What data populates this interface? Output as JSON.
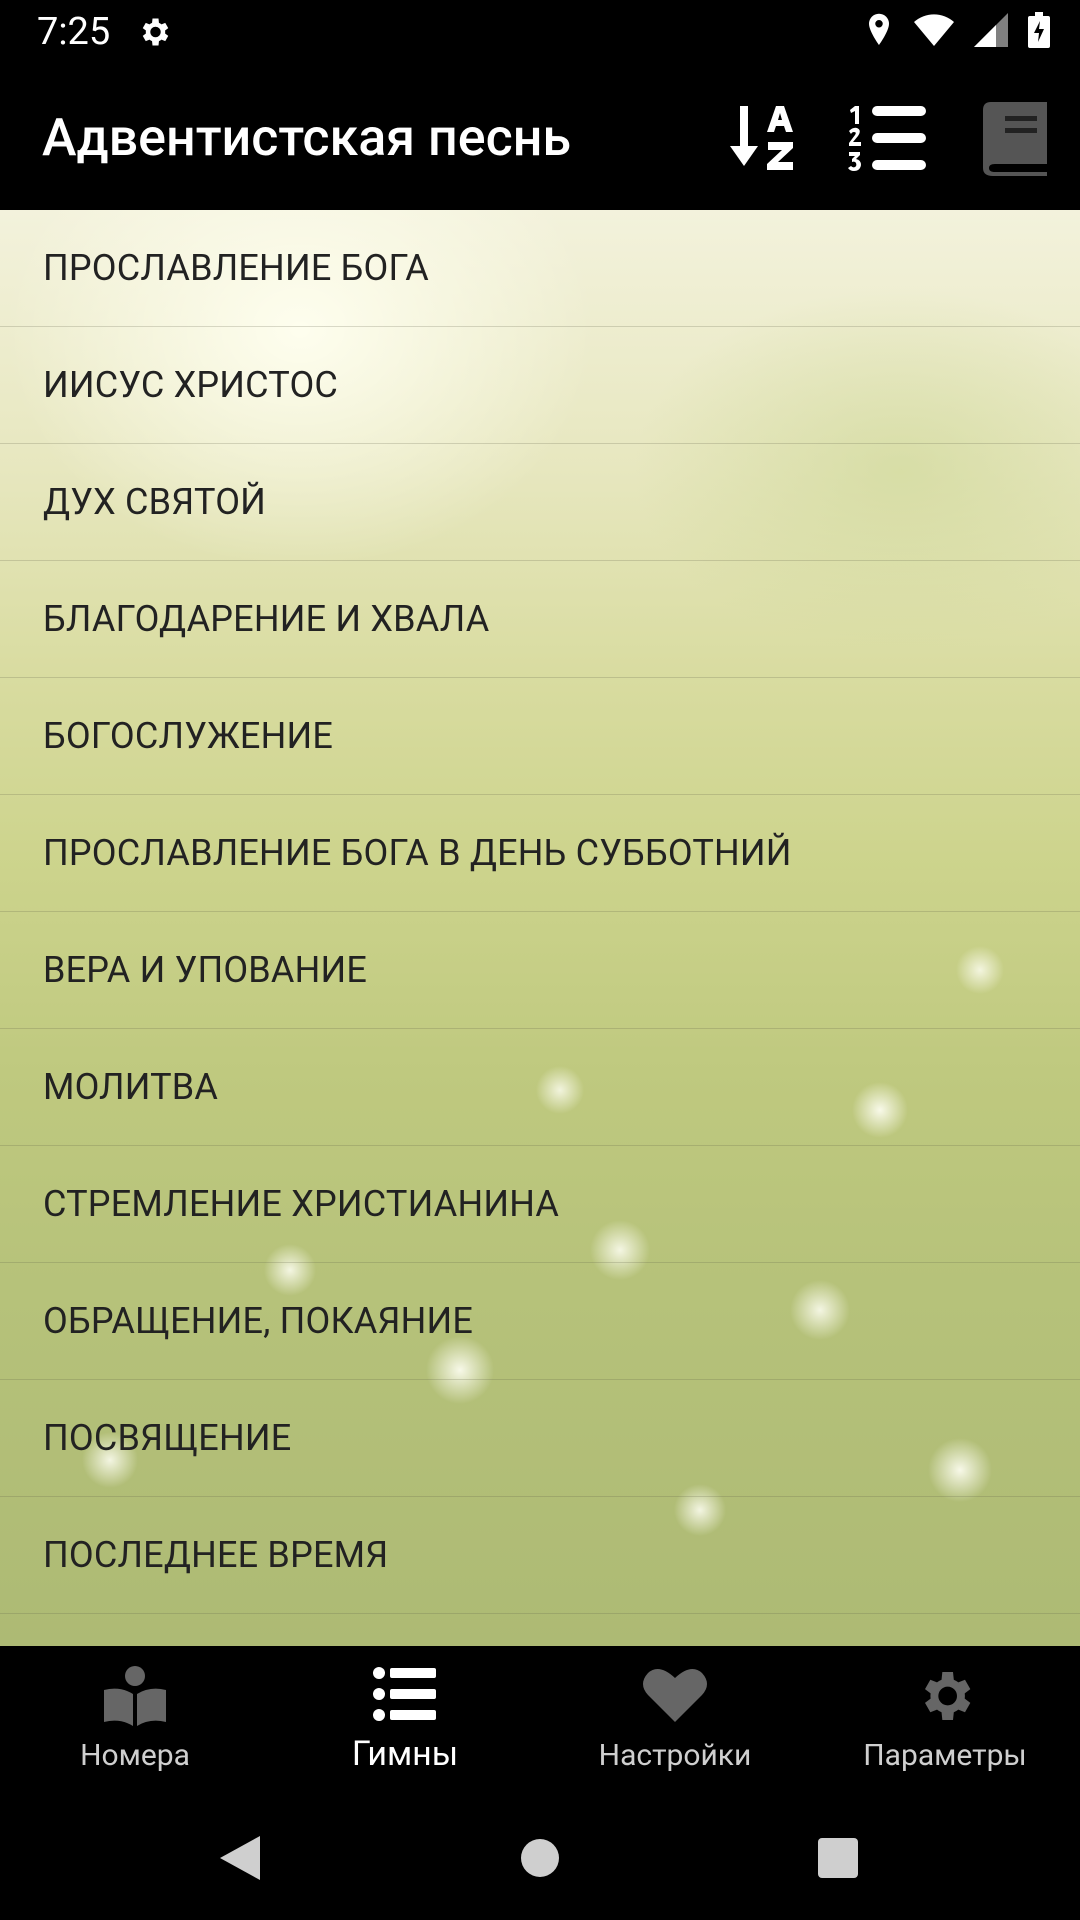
{
  "status_bar": {
    "time": "7:25",
    "icons": [
      "gear-icon",
      "location-icon",
      "wifi-icon",
      "signal-icon",
      "battery-icon"
    ]
  },
  "app_bar": {
    "title": "Адвентистская песнь",
    "actions": [
      "sort-alpha-icon",
      "sort-numeric-icon",
      "book-icon"
    ]
  },
  "categories": [
    "ПРОСЛАВЛЕНИЕ БОГА",
    "ИИСУС ХРИСТОС",
    "ДУХ СВЯТОЙ",
    "БЛАГОДАРЕНИЕ И ХВАЛА",
    "БОГОСЛУЖЕНИЕ",
    "ПРОСЛАВЛЕНИЕ БОГА В ДЕНЬ СУББОТНИЙ",
    "ВЕРА И УПОВАНИЕ",
    "МОЛИТВА",
    "СТРЕМЛЕНИЕ ХРИСТИАНИНА",
    "ОБРАЩЕНИЕ, ПОКАЯНИЕ",
    "ПОСВЯЩЕНИЕ",
    "ПОСЛЕДНЕЕ ВРЕМЯ"
  ],
  "bottom_nav": {
    "items": [
      {
        "label": "Номера",
        "icon": "book-reader-icon",
        "active": false
      },
      {
        "label": "Гимны",
        "icon": "list-icon",
        "active": true
      },
      {
        "label": "Настройки",
        "icon": "heart-icon",
        "active": false
      },
      {
        "label": "Параметры",
        "icon": "gear-icon",
        "active": false
      }
    ]
  },
  "colors": {
    "bars": "#000000",
    "list_text": "#222222",
    "nav_inactive": "#cfcfcf",
    "nav_active": "#ffffff"
  }
}
